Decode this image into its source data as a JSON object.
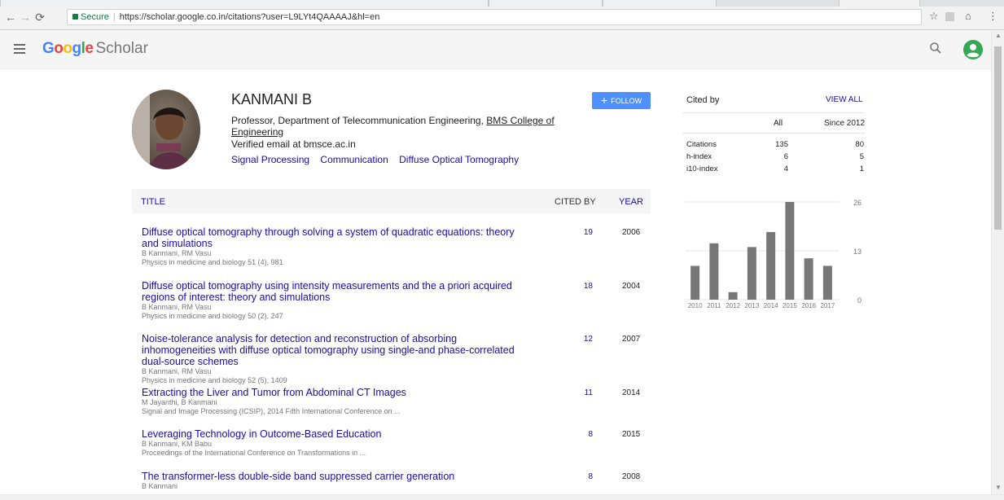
{
  "browser": {
    "secure_label": "Secure",
    "url": "https://scholar.google.co.in/citations?user=L9LYt4QAAAAJ&hl=en"
  },
  "app": {
    "brand": "Google",
    "product": "Scholar",
    "brand_colors": [
      "#4285f4",
      "#ea4335",
      "#fbbc05",
      "#4285f4",
      "#34a853",
      "#ea4335"
    ]
  },
  "profile": {
    "name": "KANMANI B",
    "affiliation_prefix": "Professor, Department of Telecommunication Engineering, ",
    "affiliation_link": "BMS College of Engineering",
    "email": "Verified email at bmsce.ac.in",
    "interests": [
      "Signal Processing",
      "Communication",
      "Diffuse Optical Tomography"
    ],
    "follow_label": "FOLLOW"
  },
  "table": {
    "col_title": "TITLE",
    "col_cited": "CITED BY",
    "col_year": "YEAR",
    "rows": [
      {
        "title": "Diffuse optical tomography through solving a system of quadratic equations: theory and simulations",
        "authors": "B Kanmani, RM Vasu",
        "venue": "Physics in medicine and biology 51 (4), 981",
        "cites": "19",
        "year": "2006"
      },
      {
        "title": "Diffuse optical tomography using intensity measurements and the a priori acquired regions of interest: theory and simulations",
        "authors": "B Kanmani, RM Vasu",
        "venue": "Physics in medicine and biology 50 (2), 247",
        "cites": "18",
        "year": "2004"
      },
      {
        "title": "Noise-tolerance analysis for detection and reconstruction of absorbing inhomogeneities with diffuse optical tomography using single-and phase-correlated dual-source schemes",
        "authors": "B Kanmani, RM Vasu",
        "venue": "Physics in medicine and biology 52 (5), 1409",
        "cites": "12",
        "year": "2007"
      },
      {
        "title": "Extracting the Liver and Tumor from Abdominal CT Images",
        "authors": "M Jayanthi, B Kanmani",
        "venue": "Signal and Image Processing (ICSIP), 2014 Fifth International Conference on ...",
        "cites": "11",
        "year": "2014"
      },
      {
        "title": "Leveraging Technology in Outcome-Based Education",
        "authors": "B Kanmani, KM Babu",
        "venue": "Proceedings of the International Conference on Transformations in ...",
        "cites": "8",
        "year": "2015"
      },
      {
        "title": "The transformer-less double-side band suppressed carrier generation",
        "authors": "B Kanmani",
        "venue": "",
        "cites": "8",
        "year": "2008"
      }
    ]
  },
  "cited_by": {
    "title": "Cited by",
    "view_all": "VIEW ALL",
    "col_all": "All",
    "col_since": "Since 2012",
    "metrics": [
      {
        "label": "Citations",
        "all": "135",
        "since": "80"
      },
      {
        "label": "h-index",
        "all": "6",
        "since": "5"
      },
      {
        "label": "i10-index",
        "all": "4",
        "since": "1"
      }
    ]
  },
  "chart_data": {
    "type": "bar",
    "categories": [
      "2010",
      "2011",
      "2012",
      "2013",
      "2014",
      "2015",
      "2016",
      "2017"
    ],
    "values": [
      9,
      15,
      2,
      14,
      18,
      26,
      11,
      9
    ],
    "y_ticks": [
      "0",
      "13",
      "26"
    ],
    "ylim": [
      0,
      26
    ],
    "bar_color": "#777777",
    "grid": true
  }
}
